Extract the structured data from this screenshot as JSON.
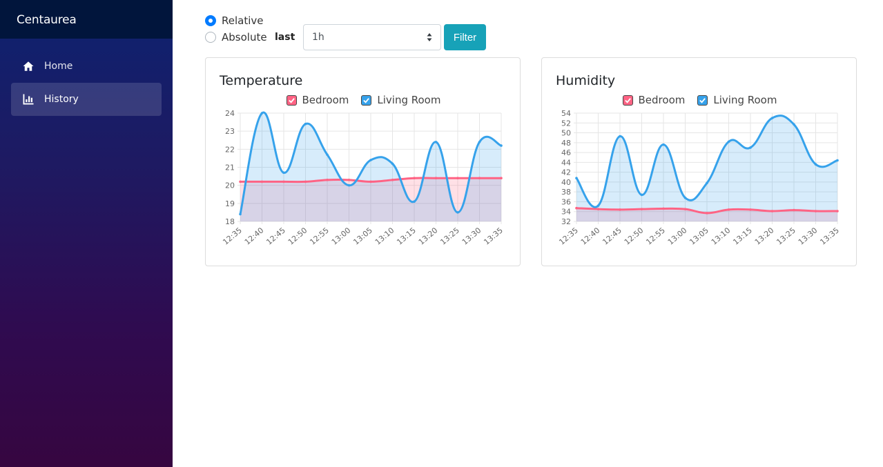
{
  "app": {
    "title": "Centaurea"
  },
  "sidebar": {
    "items": [
      {
        "label": "Home",
        "icon": "home-icon",
        "active": false
      },
      {
        "label": "History",
        "icon": "bar-chart-icon",
        "active": true
      }
    ]
  },
  "filter": {
    "relative_label": "Relative",
    "absolute_label": "Absolute",
    "selected_mode": "Relative",
    "last_label": "last",
    "range_value": "1h",
    "button_label": "Filter"
  },
  "colors": {
    "bedroom": "#ff6384",
    "living_room": "#36a2eb",
    "filter_button": "#17a2b8",
    "radio_checked": "#007bff"
  },
  "chart_data": [
    {
      "type": "area",
      "title": "Temperature",
      "legend": [
        "Bedroom",
        "Living Room"
      ],
      "x": [
        "12:35",
        "12:40",
        "12:45",
        "12:50",
        "12:55",
        "13:00",
        "13:05",
        "13:10",
        "13:15",
        "13:20",
        "13:25",
        "13:30",
        "13:35"
      ],
      "ylim": [
        18,
        24
      ],
      "yticks": [
        18,
        19,
        20,
        21,
        22,
        23,
        24
      ],
      "grid": true,
      "series": [
        {
          "name": "Bedroom",
          "values": [
            20.2,
            20.2,
            20.2,
            20.2,
            20.3,
            20.3,
            20.2,
            20.3,
            20.4,
            20.4,
            20.4,
            20.4,
            20.4
          ]
        },
        {
          "name": "Living Room",
          "values": [
            18.4,
            24.0,
            20.7,
            23.4,
            21.7,
            20.0,
            21.4,
            21.2,
            19.1,
            22.4,
            18.5,
            22.4,
            22.2
          ]
        }
      ]
    },
    {
      "type": "area",
      "title": "Humidity",
      "legend": [
        "Bedroom",
        "Living Room"
      ],
      "x": [
        "12:35",
        "12:40",
        "12:45",
        "12:50",
        "12:55",
        "13:00",
        "13:05",
        "13:10",
        "13:15",
        "13:20",
        "13:25",
        "13:30",
        "13:35"
      ],
      "ylim": [
        32,
        54
      ],
      "yticks": [
        32,
        34,
        36,
        38,
        40,
        42,
        44,
        46,
        48,
        50,
        52,
        54
      ],
      "grid": true,
      "series": [
        {
          "name": "Bedroom",
          "values": [
            34.7,
            34.5,
            34.4,
            34.5,
            34.6,
            34.5,
            33.7,
            34.4,
            34.4,
            34.1,
            34.3,
            34.1,
            34.1
          ]
        },
        {
          "name": "Living Room",
          "values": [
            40.8,
            35.2,
            49.3,
            37.4,
            47.6,
            36.8,
            39.8,
            48.2,
            47.0,
            53.0,
            51.7,
            43.6,
            44.4
          ]
        }
      ]
    }
  ]
}
